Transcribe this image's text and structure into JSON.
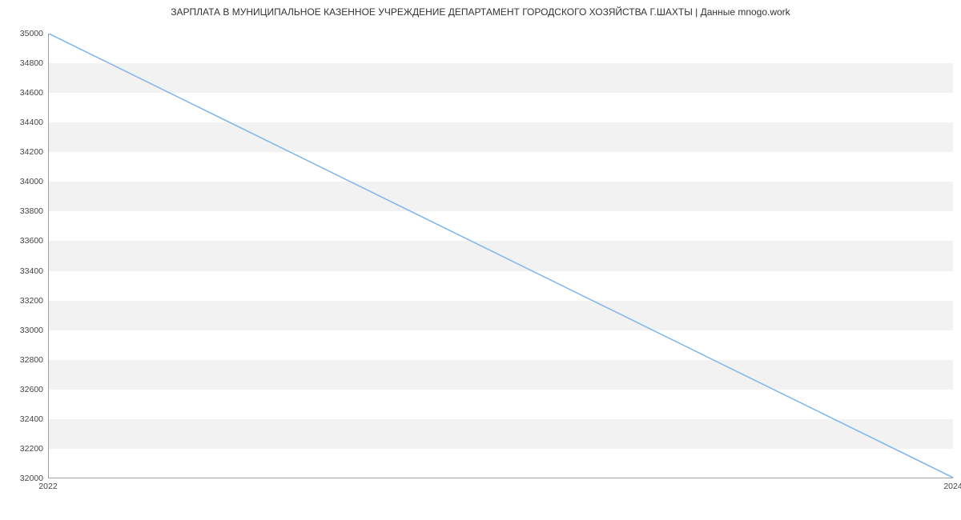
{
  "chart_data": {
    "type": "line",
    "title": "ЗАРПЛАТА В МУНИЦИПАЛЬНОЕ КАЗЕННОЕ УЧРЕЖДЕНИЕ ДЕПАРТАМЕНТ ГОРОДСКОГО ХОЗЯЙСТВА Г.ШАХТЫ | Данные mnogo.work",
    "x": [
      2022,
      2024
    ],
    "values": [
      35000,
      32000
    ],
    "xlabel": "",
    "ylabel": "",
    "xlim": [
      2022,
      2024
    ],
    "ylim": [
      32000,
      35000
    ],
    "x_ticks": [
      2022,
      2024
    ],
    "y_ticks": [
      32000,
      32200,
      32400,
      32600,
      32800,
      33000,
      33200,
      33400,
      33600,
      33800,
      34000,
      34200,
      34400,
      34600,
      34800,
      35000
    ],
    "line_color": "#7cb5ec",
    "grid_band_color": "#f2f2f2"
  }
}
